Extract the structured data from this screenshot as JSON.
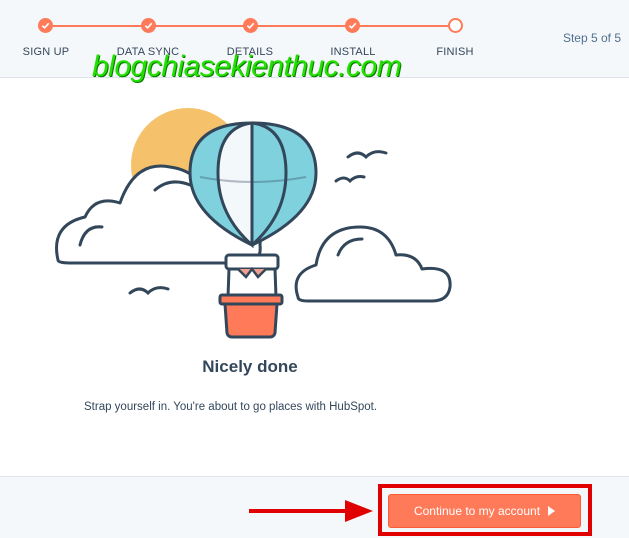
{
  "stepper": {
    "steps": [
      {
        "label": "SIGN UP",
        "status": "complete"
      },
      {
        "label": "DATA SYNC",
        "status": "complete"
      },
      {
        "label": "DETAILS",
        "status": "complete"
      },
      {
        "label": "INSTALL",
        "status": "complete"
      },
      {
        "label": "FINISH",
        "status": "pending"
      }
    ],
    "counter": "Step 5 of 5"
  },
  "watermark": "blogchiasekienthuc.com",
  "illustration": {
    "icons": [
      "sun-icon",
      "cloud-icon",
      "hot-air-balloon-icon",
      "bird-icon"
    ]
  },
  "main": {
    "title": "Nicely done",
    "subtitle": "Strap yourself in. You're about to go places with HubSpot."
  },
  "footer": {
    "cta_label": "Continue to my account",
    "cta_icon": "play-icon"
  },
  "colors": {
    "accent": "#ff7a59",
    "text": "#33475b",
    "annotation_red": "#e00000",
    "watermark_green": "#22e000",
    "sun": "#f5c26b",
    "balloon_blue": "#7fd1de"
  }
}
